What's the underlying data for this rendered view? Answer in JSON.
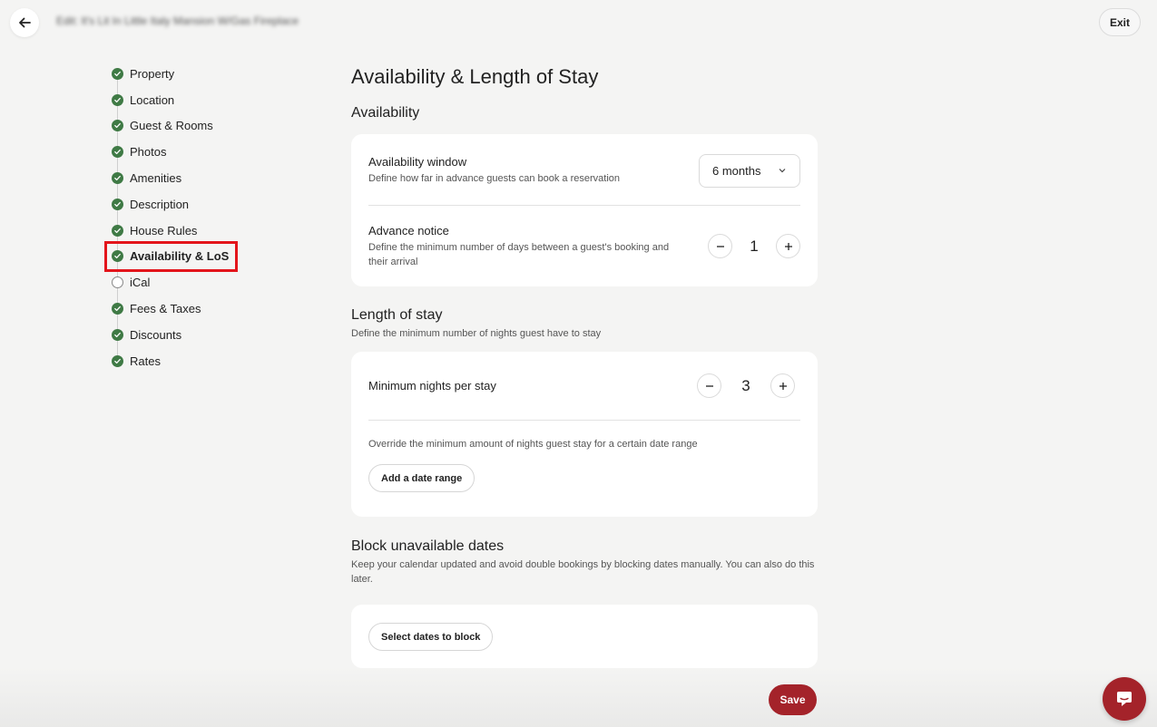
{
  "header": {
    "title": "Edit: It's Lit In Little Italy Mansion W/Gas Fireplace",
    "exit_label": "Exit"
  },
  "sidebar": {
    "items": [
      {
        "label": "Property",
        "done": true
      },
      {
        "label": "Location",
        "done": true
      },
      {
        "label": "Guest & Rooms",
        "done": true
      },
      {
        "label": "Photos",
        "done": true
      },
      {
        "label": "Amenities",
        "done": true
      },
      {
        "label": "Description",
        "done": true
      },
      {
        "label": "House Rules",
        "done": true
      },
      {
        "label": "Availability & LoS",
        "done": true,
        "active": true
      },
      {
        "label": "iCal",
        "done": false
      },
      {
        "label": "Fees & Taxes",
        "done": true
      },
      {
        "label": "Discounts",
        "done": true
      },
      {
        "label": "Rates",
        "done": true
      }
    ]
  },
  "main": {
    "title": "Availability & Length of Stay",
    "availability": {
      "heading": "Availability",
      "window": {
        "title": "Availability window",
        "description": "Define how far in advance guests can book a reservation",
        "value": "6 months"
      },
      "advance_notice": {
        "title": "Advance notice",
        "description": "Define the minimum number of days between a guest's booking and their arrival",
        "value": "1"
      }
    },
    "length_of_stay": {
      "heading": "Length of stay",
      "description": "Define the minimum number of nights guest have to stay",
      "min_nights": {
        "title": "Minimum nights per stay",
        "value": "3"
      },
      "override_text": "Override the minimum amount of nights guest stay for a certain date range",
      "add_range_label": "Add a date range"
    },
    "block_dates": {
      "heading": "Block unavailable dates",
      "description": "Keep your calendar updated and avoid double bookings by blocking dates manually. You can also do this later.",
      "select_label": "Select dates to block"
    }
  },
  "footer": {
    "save_label": "Save"
  },
  "colors": {
    "accent": "#a4232a",
    "done_green": "#3f7a45",
    "highlight_red": "#e3141b"
  }
}
